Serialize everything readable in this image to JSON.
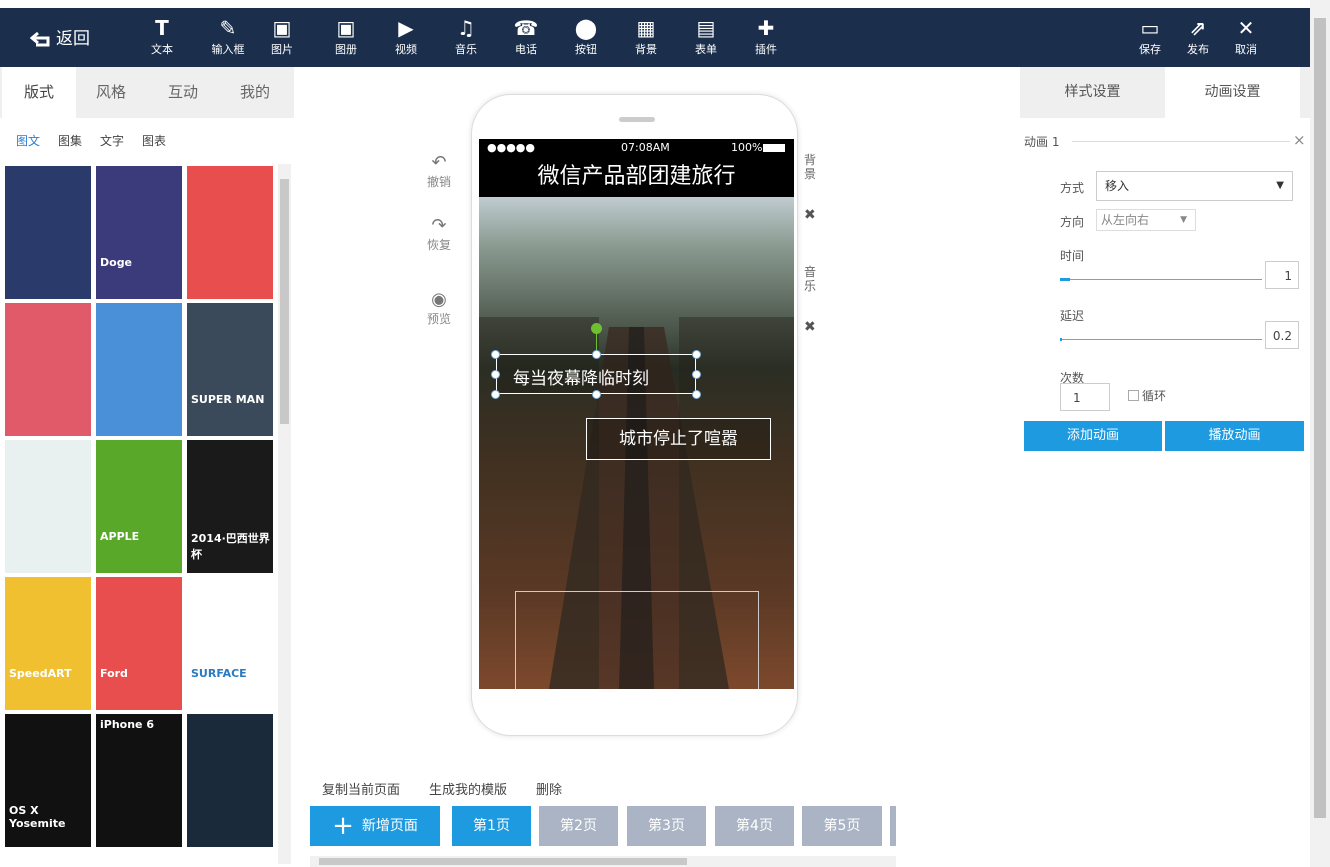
{
  "toolbar": {
    "back_label": "返回",
    "tools": [
      {
        "label": "文本",
        "icon": "text-icon",
        "glyph": "T"
      },
      {
        "label": "输入框",
        "icon": "pen-icon",
        "glyph": "✎"
      },
      {
        "label": "图片",
        "icon": "image-icon",
        "glyph": "▣"
      },
      {
        "label": "图册",
        "icon": "album-icon",
        "glyph": "▣"
      },
      {
        "label": "视频",
        "icon": "video-icon",
        "glyph": "▶"
      },
      {
        "label": "音乐",
        "icon": "music-icon",
        "glyph": "♫"
      },
      {
        "label": "电话",
        "icon": "phone-icon",
        "glyph": "☎"
      },
      {
        "label": "按钮",
        "icon": "toggle-icon",
        "glyph": "⬤"
      },
      {
        "label": "背景",
        "icon": "grid-icon",
        "glyph": "▦"
      },
      {
        "label": "表单",
        "icon": "form-icon",
        "glyph": "▤"
      },
      {
        "label": "插件",
        "icon": "plugin-icon",
        "glyph": "✚"
      }
    ],
    "right_tools": [
      {
        "label": "保存",
        "icon": "save-icon",
        "glyph": "▭"
      },
      {
        "label": "发布",
        "icon": "publish-icon",
        "glyph": "⇗"
      },
      {
        "label": "取消",
        "icon": "close-icon",
        "glyph": "✕"
      }
    ]
  },
  "left_panel": {
    "tabs": [
      "版式",
      "风格",
      "互动",
      "我的"
    ],
    "subtabs": [
      "图文",
      "图集",
      "文字",
      "图表"
    ],
    "thumbs": [
      {
        "text": "",
        "color": "#2a3a6a"
      },
      {
        "text": "Doge",
        "color": "#3b3a7a"
      },
      {
        "text": "",
        "color": "#e84e4e"
      },
      {
        "text": "",
        "color": "#e05a6a"
      },
      {
        "text": "",
        "color": "#4a90d9"
      },
      {
        "text": "SUPER MAN",
        "color": "#3a4a5a"
      },
      {
        "text": "",
        "color": "#e8f0f0"
      },
      {
        "text": "APPLE",
        "color": "#5aa82a"
      },
      {
        "text": "2014·巴西世界杯",
        "color": "#1a1a1a"
      },
      {
        "text": "SpeedART",
        "color": "#f0c030"
      },
      {
        "text": "Ford",
        "color": "#e84e4e"
      },
      {
        "text": "SURFACE",
        "color": "#ffffff"
      },
      {
        "text": "OS X Yosemite",
        "color": "#111111"
      },
      {
        "text": "iPhone 6",
        "color": "#111111"
      },
      {
        "text": "",
        "color": "#1a2a3a"
      }
    ]
  },
  "canvas": {
    "undo": "撤销",
    "redo": "恢复",
    "preview": "预览",
    "status_time": "07:08AM",
    "status_battery": "100%",
    "status_signal": "●●●●●",
    "page_title": "微信产品部团建旅行",
    "text1": "每当夜幕降临时刻",
    "text2": "城市停止了喧嚣",
    "side_bg": "背景",
    "side_music": "音乐",
    "ops": [
      "复制当前页面",
      "生成我的模版",
      "删除"
    ],
    "add_page": "新增页面",
    "pages": [
      "第1页",
      "第2页",
      "第3页",
      "第4页",
      "第5页"
    ]
  },
  "right_panel": {
    "tabs": [
      "样式设置",
      "动画设置"
    ],
    "anim_title": "动画 1",
    "mode_label": "方式",
    "mode_value": "移入",
    "dir_label": "方向",
    "dir_value": "从左向右",
    "time_label": "时间",
    "time_value": "1",
    "delay_label": "延迟",
    "delay_value": "0.2",
    "count_label": "次数",
    "count_value": "1",
    "loop_label": "循环",
    "add_btn": "添加动画",
    "play_btn": "播放动画"
  },
  "colors": {
    "topbar": "#1b2f4d",
    "accent": "#1e9ae0",
    "page_inactive": "#aab4c4"
  }
}
